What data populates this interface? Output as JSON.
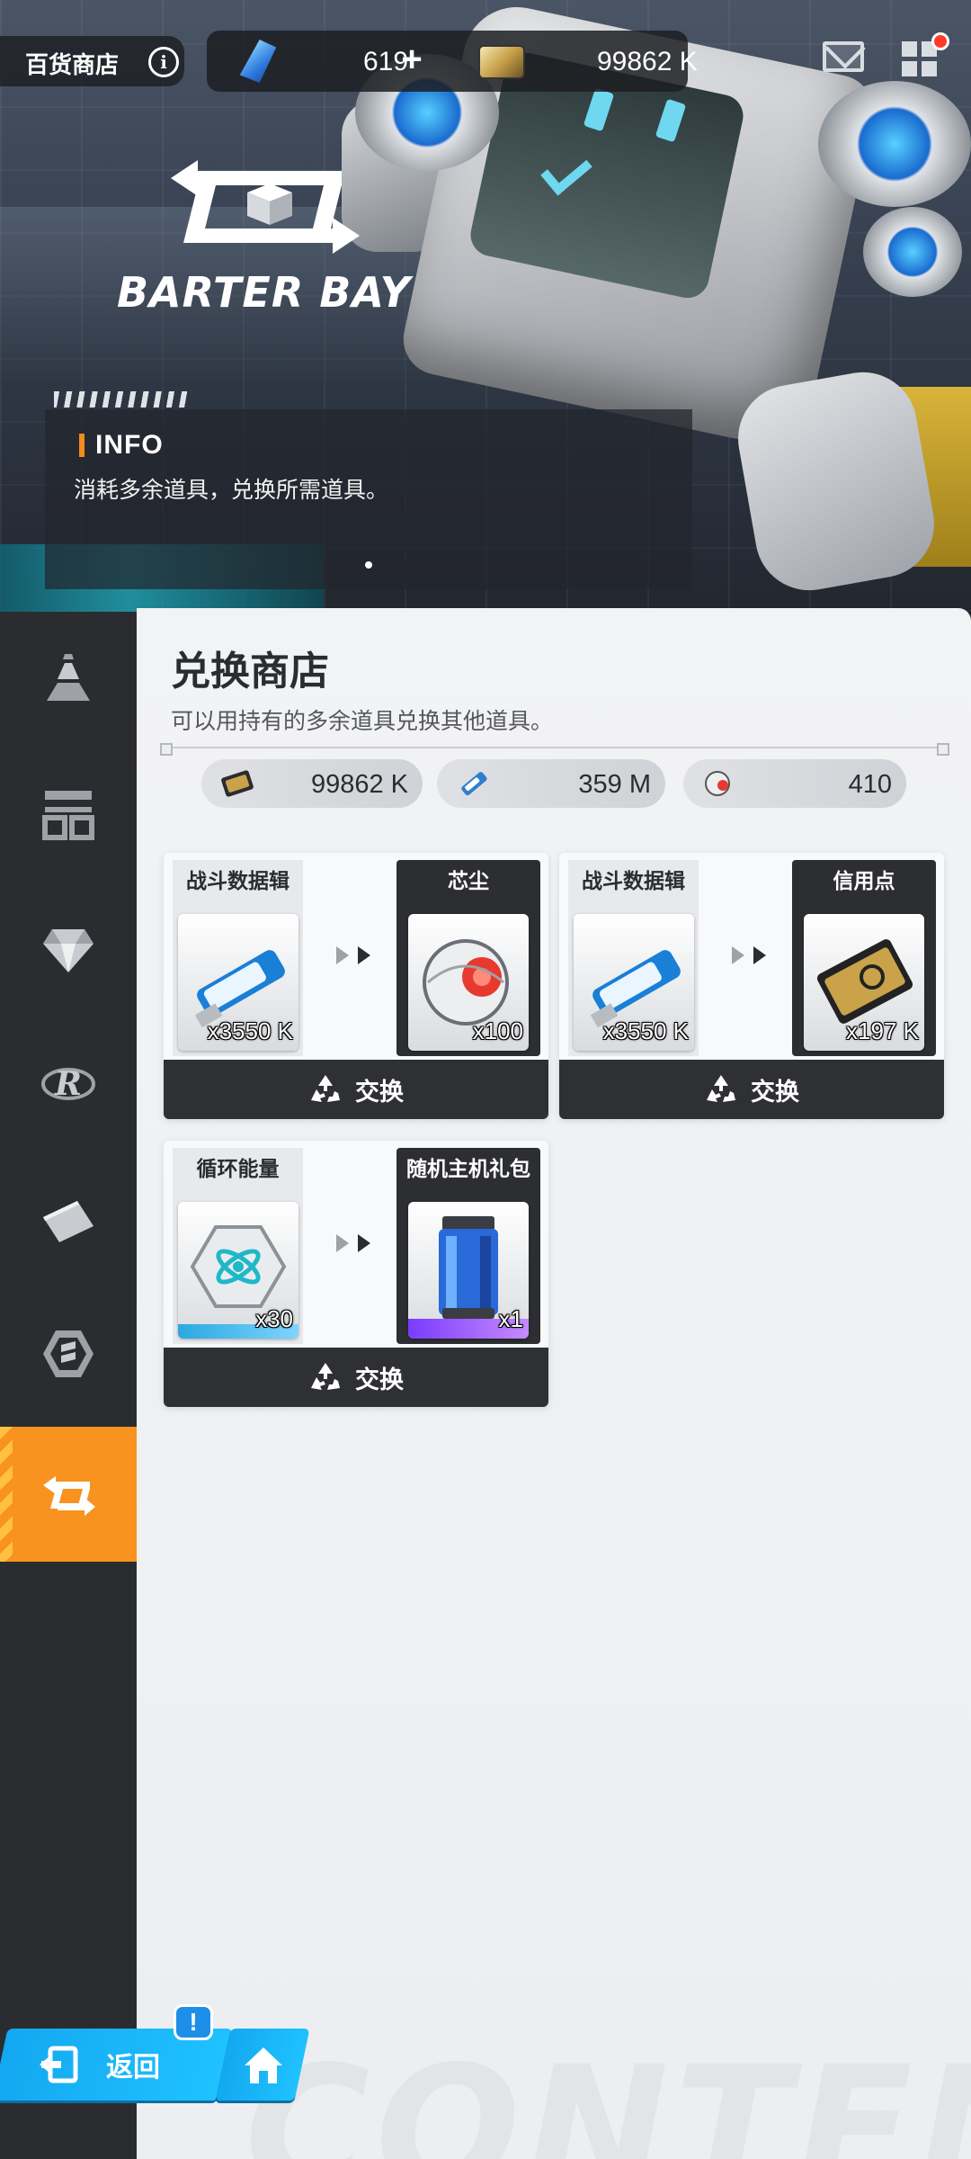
{
  "header": {
    "shop_title": "百货商店",
    "gem_count": "619",
    "credit_count": "99862 K"
  },
  "banner": {
    "logo_text": "BARTER BAY",
    "info_title": "INFO",
    "info_text": "消耗多余道具，兑换所需道具。"
  },
  "sidebar": {
    "items": [
      {
        "icon": "general-shop-icon",
        "active": false
      },
      {
        "icon": "arena-shop-icon",
        "active": false
      },
      {
        "icon": "gem-shop-icon",
        "active": false
      },
      {
        "icon": "recycle-shop-icon",
        "active": false
      },
      {
        "icon": "ticket-shop-icon",
        "active": false
      },
      {
        "icon": "hex-shop-icon",
        "active": false
      },
      {
        "icon": "barter-exchange-icon",
        "active": true
      }
    ]
  },
  "main": {
    "title": "兑换商店",
    "subtitle": "可以用持有的多余道具兑换其他道具。",
    "balances": [
      {
        "icon": "credit-card-icon",
        "value": "99862 K"
      },
      {
        "icon": "battle-data-icon",
        "value": "359 M"
      },
      {
        "icon": "core-dust-icon",
        "value": "410"
      }
    ],
    "exchange_label": "交换",
    "cards": [
      {
        "source": {
          "name": "战斗数据辑",
          "qty": "x3550 K",
          "icon": "battle-data-icon"
        },
        "target": {
          "name": "芯尘",
          "qty": "x100",
          "icon": "core-dust-icon"
        }
      },
      {
        "source": {
          "name": "战斗数据辑",
          "qty": "x3550 K",
          "icon": "battle-data-icon"
        },
        "target": {
          "name": "信用点",
          "qty": "x197 K",
          "icon": "credit-card-icon"
        }
      },
      {
        "source": {
          "name": "循环能量",
          "qty": "x30",
          "icon": "recycle-energy-icon"
        },
        "target": {
          "name": "随机主机礼包",
          "qty": "x1",
          "icon": "random-gift-pack-icon"
        }
      }
    ],
    "watermark": "CONTENT"
  },
  "footer": {
    "back_label": "返回",
    "alert_badge": "!"
  },
  "colors": {
    "accent": "#f7931e",
    "dark_panel": "#2b2c30",
    "back_button": "#1fb4f5"
  }
}
